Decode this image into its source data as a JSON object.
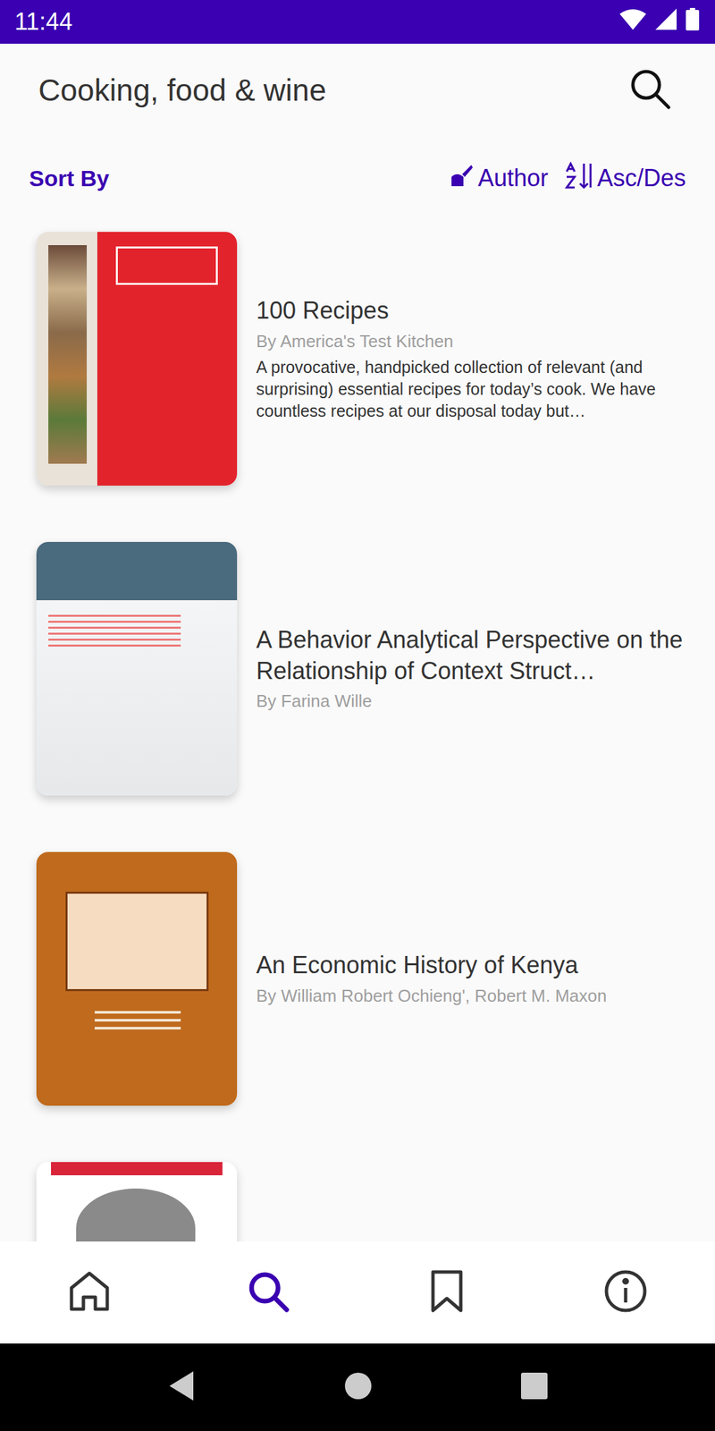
{
  "status_bar": {
    "time": "11:44"
  },
  "toolbar": {
    "title": "Cooking, food & wine"
  },
  "sort": {
    "label": "Sort By",
    "field": "Author",
    "order": "Asc/Des"
  },
  "books": [
    {
      "kind": "full",
      "title": "100 Recipes",
      "author": "By America's Test Kitchen",
      "description": "A provocative, handpicked collection of relevant (and surprising) essential recipes for today’s cook. We have countless recipes at our disposal today but…"
    },
    {
      "kind": "full",
      "title": "A Behavior Analytical Perspective on the Relationship of Context Struct…",
      "author": "By Farina Wille",
      "description": ""
    },
    {
      "kind": "full",
      "title": "An Economic History of Kenya",
      "author": "By William Robert Ochieng', Robert M. Maxon",
      "description": ""
    },
    {
      "kind": "partial",
      "title": "",
      "author": "",
      "description": ""
    }
  ],
  "nav": [
    {
      "selected": false
    },
    {
      "selected": true
    },
    {
      "selected": false
    },
    {
      "selected": false
    }
  ]
}
